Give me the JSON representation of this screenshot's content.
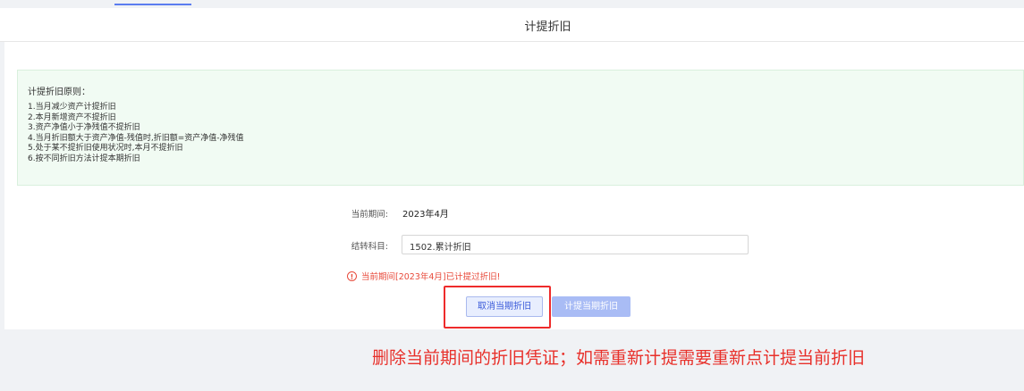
{
  "header": {
    "title": "计提折旧"
  },
  "rules": {
    "title": "计提折旧原则：",
    "items": [
      "1.当月减少资产计提折旧",
      "2.本月新增资产不提折旧",
      "3.资产净值小于净残值不提折旧",
      "4.当月折旧额大于资产净值-残值时,折旧额=资产净值-净残值",
      "5.处于某不提折旧使用状况时,本月不提折旧",
      "6.按不同折旧方法计提本期折旧"
    ]
  },
  "form": {
    "period_label": "当前期间:",
    "period_value": "2023年4月",
    "subject_label": "结转科目:",
    "subject_value": "1502.累计折旧"
  },
  "warning": {
    "icon": "exclamation-circle-icon",
    "text": "当前期间[2023年4月]已计提过折旧!"
  },
  "buttons": {
    "cancel_label": "取消当期折旧",
    "accrue_label": "计提当期折旧"
  },
  "annotation": {
    "text": "删除当前期间的折旧凭证；如需重新计提需要重新点计提当前折旧"
  },
  "colors": {
    "accent": "#5b7cf0",
    "warning": "#e84b3c",
    "highlight": "#ee2b2b",
    "rules_bg": "#f1fbf3"
  }
}
